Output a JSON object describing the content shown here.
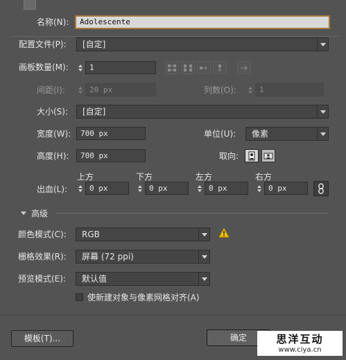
{
  "dialog": {
    "name_label": "名称(N):",
    "name_value": "Adolescente",
    "profile_label": "配置文件(P):",
    "profile_value": "[自定]",
    "artboards_label": "画板数量(M):",
    "artboards_value": "1",
    "spacing_label": "间距(I):",
    "spacing_value": "20 px",
    "columns_label": "列数(O):",
    "columns_value": "1",
    "size_label": "大小(S):",
    "size_value": "[自定]",
    "width_label": "宽度(W):",
    "width_value": "700 px",
    "units_label": "单位(U):",
    "units_value": "像素",
    "height_label": "高度(H):",
    "height_value": "700 px",
    "orientation_label": "取向:",
    "bleed_label": "出血(L):",
    "bleed": {
      "top_label": "上方",
      "top_value": "0 px",
      "bottom_label": "下方",
      "bottom_value": "0 px",
      "left_label": "左方",
      "left_value": "0 px",
      "right_label": "右方",
      "right_value": "0 px"
    },
    "advanced_label": "高级",
    "color_mode_label": "颜色模式(C):",
    "color_mode_value": "RGB",
    "raster_label": "栅格效果(R):",
    "raster_value": "屏幕 (72 ppi)",
    "preview_label": "预览模式(E):",
    "preview_value": "默认值",
    "align_pixel_label": "使新建对象与像素网格对齐(A)",
    "templates_button": "模板(T)...",
    "ok_button": "确定",
    "watermark_text": "思洋互动",
    "watermark_url": "www.ciya.cn"
  }
}
